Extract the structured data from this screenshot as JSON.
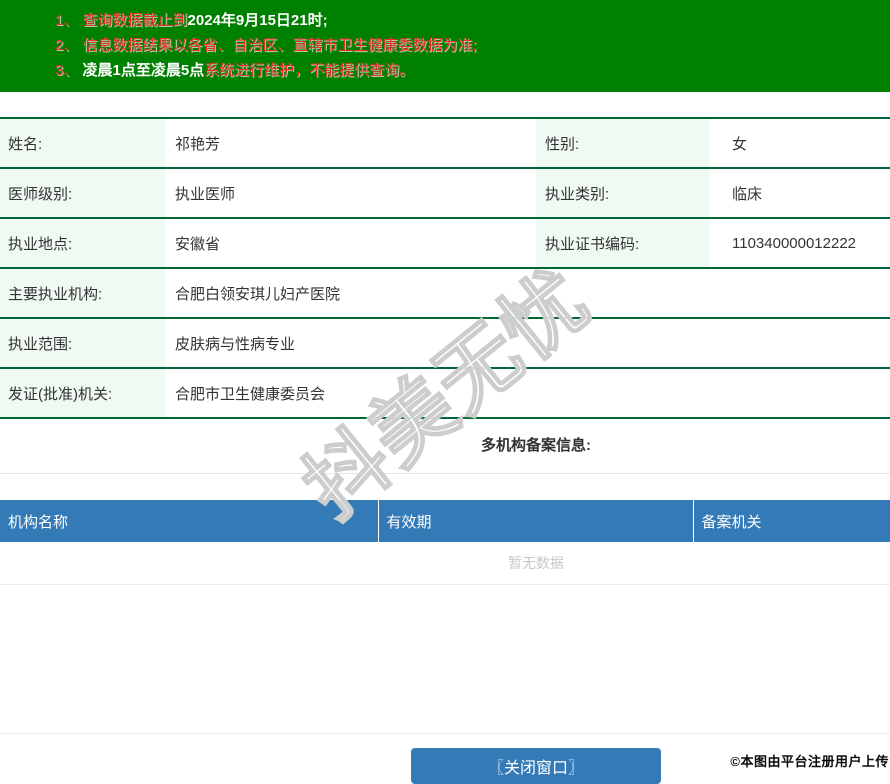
{
  "notice_bar": {
    "bg_color": "#008000",
    "red_text_color": "#f12b2b",
    "highlight_text_color": "#ffffff",
    "lines": [
      {
        "red1": "1、 查询数据截止到",
        "white": "2024年9月15日21时;",
        "red2": ""
      },
      {
        "red1": "2、 信息数据结果以各省、自治区、直辖市卫生健康委数据为准;",
        "white": "",
        "red2": ""
      },
      {
        "red1": "3、 ",
        "white": "凌晨1点至凌晨5点",
        "red2": "系统进行维护，不能提供查询。"
      }
    ]
  },
  "doctor_info": {
    "border_color": "#006837",
    "label_bg_color": "#effaf3",
    "rows": [
      {
        "label": "姓名:",
        "value": "祁艳芳",
        "label2": "性别:",
        "value2": "女"
      },
      {
        "label": "医师级别:",
        "value": "执业医师",
        "label2": "执业类别:",
        "value2": "临床"
      },
      {
        "label": "执业地点:",
        "value": "安徽省",
        "label2": "执业证书编码:",
        "value2": "110340000012222"
      },
      {
        "label": "主要执业机构:",
        "value": "合肥白领安琪儿妇产医院"
      },
      {
        "label": "执业范围:",
        "value": "皮肤病与性病专业"
      },
      {
        "label": "发证(批准)机关:",
        "value": "合肥市卫生健康委员会"
      }
    ]
  },
  "filing_section": {
    "title": "多机构备案信息:",
    "header_bg_color": "#337ab7",
    "headers": [
      "机构名称",
      "有效期",
      "备案机关"
    ],
    "empty_text": "暂无数据"
  },
  "footer": {
    "close_button_label": "〖关闭窗口〗",
    "copyright": "©本图由平台注册用户上传"
  },
  "watermark": {
    "text": "抖美无忧"
  }
}
